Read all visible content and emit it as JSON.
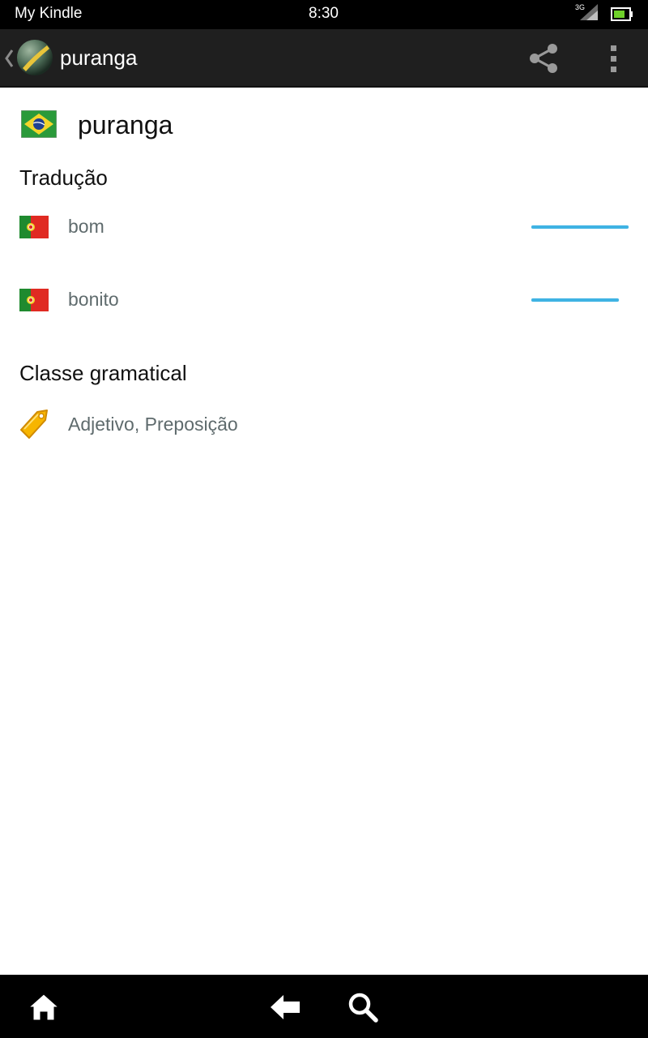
{
  "status_bar": {
    "carrier": "My Kindle",
    "time": "8:30",
    "network": "3G"
  },
  "action_bar": {
    "title": "puranga",
    "icons": [
      "up-caret-icon",
      "app-globe-icon",
      "share-icon",
      "overflow-menu-icon"
    ]
  },
  "entry": {
    "word": "puranga",
    "language_flag": "brazil-flag-icon",
    "translation_title": "Tradução",
    "translations": [
      {
        "text": "bom",
        "flag": "portugal-flag-icon",
        "relevance": 1.0
      },
      {
        "text": "bonito",
        "flag": "portugal-flag-icon",
        "relevance": 0.9
      }
    ],
    "grammar_title": "Classe gramatical",
    "grammar_value": "Adjetivo, Preposição",
    "grammar_icon": "tag-icon"
  },
  "nav_bar": {
    "icons": [
      "home-icon",
      "back-icon",
      "search-icon"
    ]
  },
  "colors": {
    "relevance_bar": "#3fb3e3",
    "secondary_text": "#5f6b6d",
    "action_bar_bg": "#1f1f1f"
  }
}
